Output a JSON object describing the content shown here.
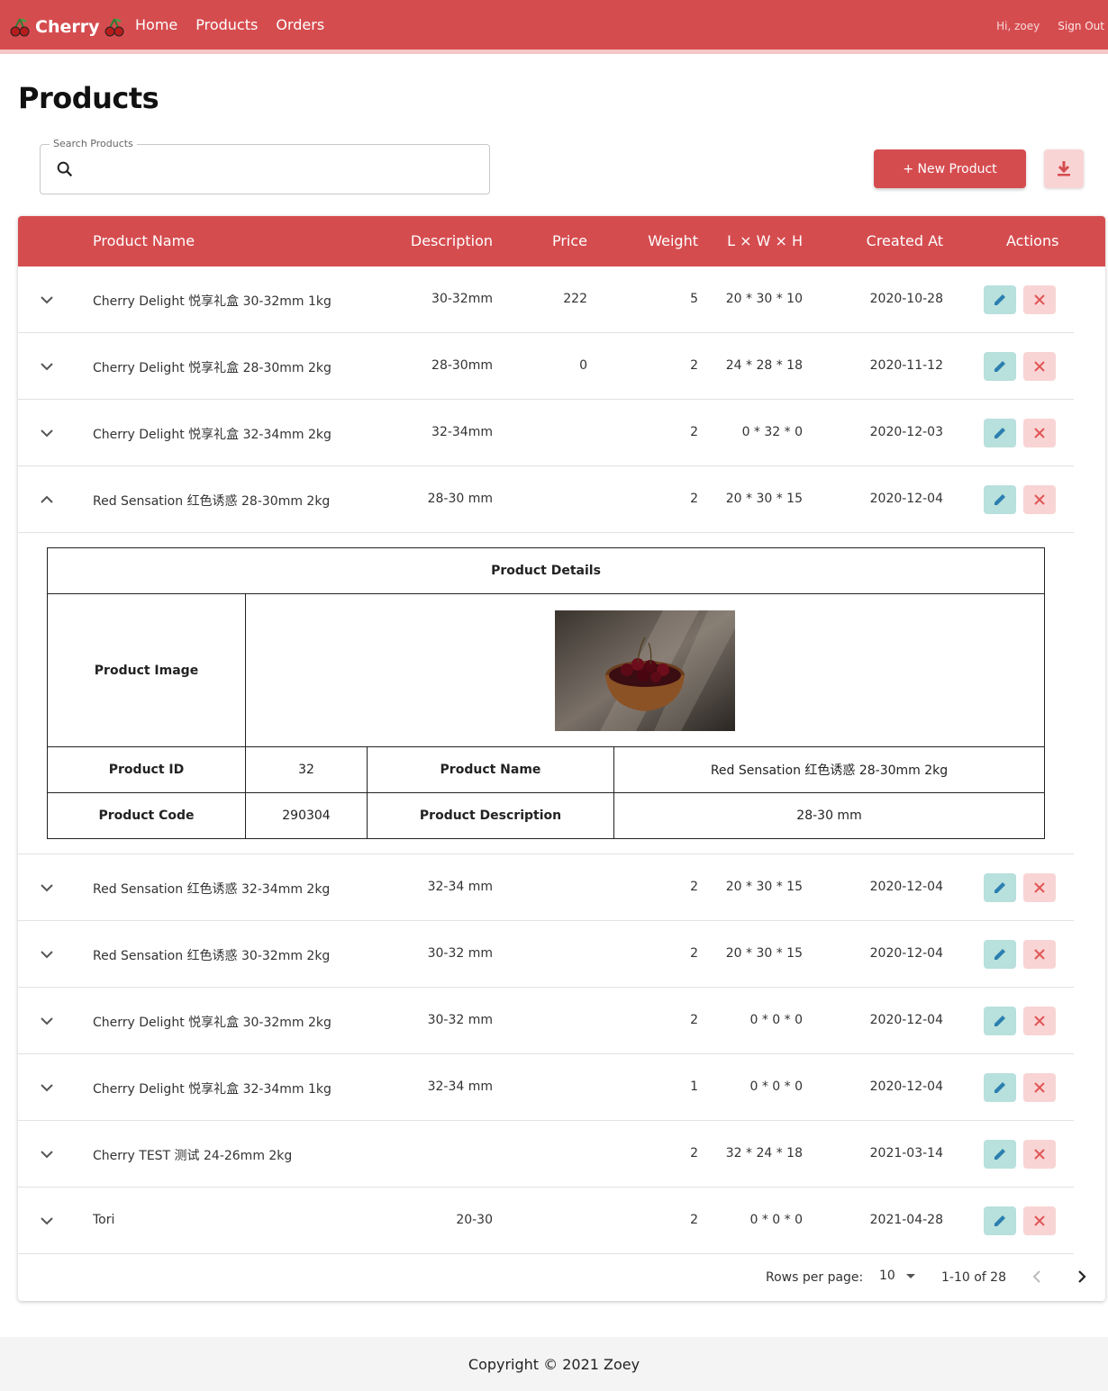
{
  "header": {
    "brand": "Cherry",
    "nav": [
      "Home",
      "Products",
      "Orders"
    ],
    "greeting": "Hi, zoey",
    "sign_out": "Sign Out"
  },
  "page": {
    "title": "Products",
    "search_label": "Search Products",
    "search_value": "",
    "new_product": "+ New Product"
  },
  "table": {
    "columns": [
      "Product Name",
      "Description",
      "Price",
      "Weight",
      "L × W × H",
      "Created At",
      "Actions"
    ],
    "rows": [
      {
        "name": "Cherry Delight 悦享礼盒 30-32mm 1kg",
        "desc": "30-32mm",
        "price": "222",
        "weight": "5",
        "dims": "20 * 30 * 10",
        "created": "2020-10-28"
      },
      {
        "name": "Cherry Delight 悦享礼盒 28-30mm 2kg",
        "desc": "28-30mm",
        "price": "0",
        "weight": "2",
        "dims": "24 * 28 * 18",
        "created": "2020-11-12"
      },
      {
        "name": "Cherry Delight 悦享礼盒 32-34mm 2kg",
        "desc": "32-34mm",
        "price": "",
        "weight": "2",
        "dims": "0 * 32 * 0",
        "created": "2020-12-03"
      },
      {
        "name": "Red Sensation 红色诱惑 28-30mm 2kg",
        "desc": "28-30 mm",
        "price": "",
        "weight": "2",
        "dims": "20 * 30 * 15",
        "created": "2020-12-04"
      },
      {
        "name": "Red Sensation 红色诱惑 32-34mm 2kg",
        "desc": "32-34 mm",
        "price": "",
        "weight": "2",
        "dims": "20 * 30 * 15",
        "created": "2020-12-04"
      },
      {
        "name": "Red Sensation 红色诱惑 30-32mm 2kg",
        "desc": "30-32 mm",
        "price": "",
        "weight": "2",
        "dims": "20 * 30 * 15",
        "created": "2020-12-04"
      },
      {
        "name": "Cherry Delight 悦享礼盒 30-32mm 2kg",
        "desc": "30-32 mm",
        "price": "",
        "weight": "2",
        "dims": "0 * 0 * 0",
        "created": "2020-12-04"
      },
      {
        "name": "Cherry Delight 悦享礼盒 32-34mm 1kg",
        "desc": "32-34 mm",
        "price": "",
        "weight": "1",
        "dims": "0 * 0 * 0",
        "created": "2020-12-04"
      },
      {
        "name": "Cherry TEST 测试 24-26mm 2kg",
        "desc": "",
        "price": "",
        "weight": "2",
        "dims": "32 * 24 * 18",
        "created": "2021-03-14"
      },
      {
        "name": "Tori",
        "desc": "20-30",
        "price": "",
        "weight": "2",
        "dims": "0 * 0 * 0",
        "created": "2021-04-28"
      }
    ]
  },
  "details": {
    "title": "Product Details",
    "image_label": "Product Image",
    "id_label": "Product ID",
    "id_value": "32",
    "name_label": "Product Name",
    "name_value": "Red Sensation 红色诱惑 28-30mm 2kg",
    "code_label": "Product Code",
    "code_value": "290304",
    "desc_label": "Product Description",
    "desc_value": "28-30 mm"
  },
  "pagination": {
    "rows_label": "Rows per page:",
    "rows_value": "10",
    "range": "1-10 of 28"
  },
  "footer": "Copyright © 2021 Zoey",
  "colors": {
    "brand": "#d54c4f",
    "edit": "#b8e0dc",
    "delete": "#f9d4d4"
  }
}
